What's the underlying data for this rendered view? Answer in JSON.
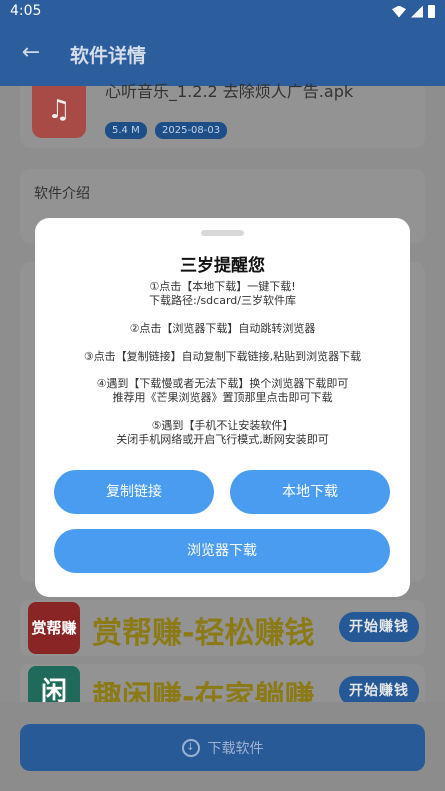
{
  "status_bar": {
    "time": "4:05"
  },
  "header": {
    "title": "软件详情"
  },
  "app": {
    "filename": "心听音乐_1.2.2 去除烦人广告.apk",
    "size": "5.4 M",
    "date": "2025-08-03"
  },
  "intro": {
    "title": "软件介绍"
  },
  "modal": {
    "title": "三岁提醒您",
    "tip1_line1": "①点击【本地下载】一键下载!",
    "tip1_line2": "下载路径:/sdcard/三岁软件库",
    "tip2": "②点击【浏览器下载】自动跳转浏览器",
    "tip3": "③点击【复制链接】自动复制下载链接,粘贴到浏览器下载",
    "tip4_line1": "④遇到【下载慢或者无法下载】换个浏览器下载即可",
    "tip4_line2": "推荐用《芒果浏览器》置顶那里点击即可下载",
    "tip5_line1": "⑤遇到【手机不让安装软件】",
    "tip5_line2": "关闭手机网络或开启飞行模式,断网安装即可",
    "btn_copy": "复制链接",
    "btn_local": "本地下载",
    "btn_browser": "浏览器下载"
  },
  "ads": [
    {
      "logo": "赏帮赚",
      "text": "赏帮赚-轻松赚钱",
      "button": "开始赚钱"
    },
    {
      "logo": "闲",
      "text": "趣闲赚-在家躺赚",
      "button": "开始赚钱"
    }
  ],
  "bottom": {
    "download_label": "下载软件"
  }
}
